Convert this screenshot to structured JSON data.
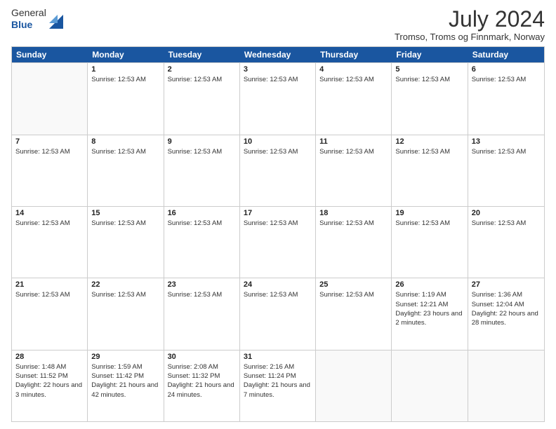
{
  "logo": {
    "line1": "General",
    "line2": "Blue"
  },
  "title": {
    "month_year": "July 2024",
    "location": "Tromso, Troms og Finnmark, Norway"
  },
  "calendar": {
    "headers": [
      "Sunday",
      "Monday",
      "Tuesday",
      "Wednesday",
      "Thursday",
      "Friday",
      "Saturday"
    ],
    "weeks": [
      {
        "days": [
          {
            "num": "",
            "info": "",
            "empty": true
          },
          {
            "num": "1",
            "info": "Sunrise: 12:53 AM"
          },
          {
            "num": "2",
            "info": "Sunrise: 12:53 AM"
          },
          {
            "num": "3",
            "info": "Sunrise: 12:53 AM"
          },
          {
            "num": "4",
            "info": "Sunrise: 12:53 AM"
          },
          {
            "num": "5",
            "info": "Sunrise: 12:53 AM"
          },
          {
            "num": "6",
            "info": "Sunrise: 12:53 AM"
          }
        ]
      },
      {
        "days": [
          {
            "num": "7",
            "info": "Sunrise: 12:53 AM"
          },
          {
            "num": "8",
            "info": "Sunrise: 12:53 AM"
          },
          {
            "num": "9",
            "info": "Sunrise: 12:53 AM"
          },
          {
            "num": "10",
            "info": "Sunrise: 12:53 AM"
          },
          {
            "num": "11",
            "info": "Sunrise: 12:53 AM"
          },
          {
            "num": "12",
            "info": "Sunrise: 12:53 AM"
          },
          {
            "num": "13",
            "info": "Sunrise: 12:53 AM"
          }
        ]
      },
      {
        "days": [
          {
            "num": "14",
            "info": "Sunrise: 12:53 AM"
          },
          {
            "num": "15",
            "info": "Sunrise: 12:53 AM"
          },
          {
            "num": "16",
            "info": "Sunrise: 12:53 AM"
          },
          {
            "num": "17",
            "info": "Sunrise: 12:53 AM"
          },
          {
            "num": "18",
            "info": "Sunrise: 12:53 AM"
          },
          {
            "num": "19",
            "info": "Sunrise: 12:53 AM"
          },
          {
            "num": "20",
            "info": "Sunrise: 12:53 AM"
          }
        ]
      },
      {
        "days": [
          {
            "num": "21",
            "info": "Sunrise: 12:53 AM"
          },
          {
            "num": "22",
            "info": "Sunrise: 12:53 AM"
          },
          {
            "num": "23",
            "info": "Sunrise: 12:53 AM"
          },
          {
            "num": "24",
            "info": "Sunrise: 12:53 AM"
          },
          {
            "num": "25",
            "info": "Sunrise: 12:53 AM"
          },
          {
            "num": "26",
            "info": "Sunrise: 1:19 AM\nSunset: 12:21 AM\nDaylight: 23 hours and 2 minutes."
          },
          {
            "num": "27",
            "info": "Sunrise: 1:36 AM\nSunset: 12:04 AM\nDaylight: 22 hours and 28 minutes."
          }
        ]
      },
      {
        "days": [
          {
            "num": "28",
            "info": "Sunrise: 1:48 AM\nSunset: 11:52 PM\nDaylight: 22 hours and 3 minutes."
          },
          {
            "num": "29",
            "info": "Sunrise: 1:59 AM\nSunset: 11:42 PM\nDaylight: 21 hours and 42 minutes."
          },
          {
            "num": "30",
            "info": "Sunrise: 2:08 AM\nSunset: 11:32 PM\nDaylight: 21 hours and 24 minutes."
          },
          {
            "num": "31",
            "info": "Sunrise: 2:16 AM\nSunset: 11:24 PM\nDaylight: 21 hours and 7 minutes."
          },
          {
            "num": "",
            "info": "",
            "empty": true
          },
          {
            "num": "",
            "info": "",
            "empty": true
          },
          {
            "num": "",
            "info": "",
            "empty": true
          }
        ]
      }
    ]
  }
}
